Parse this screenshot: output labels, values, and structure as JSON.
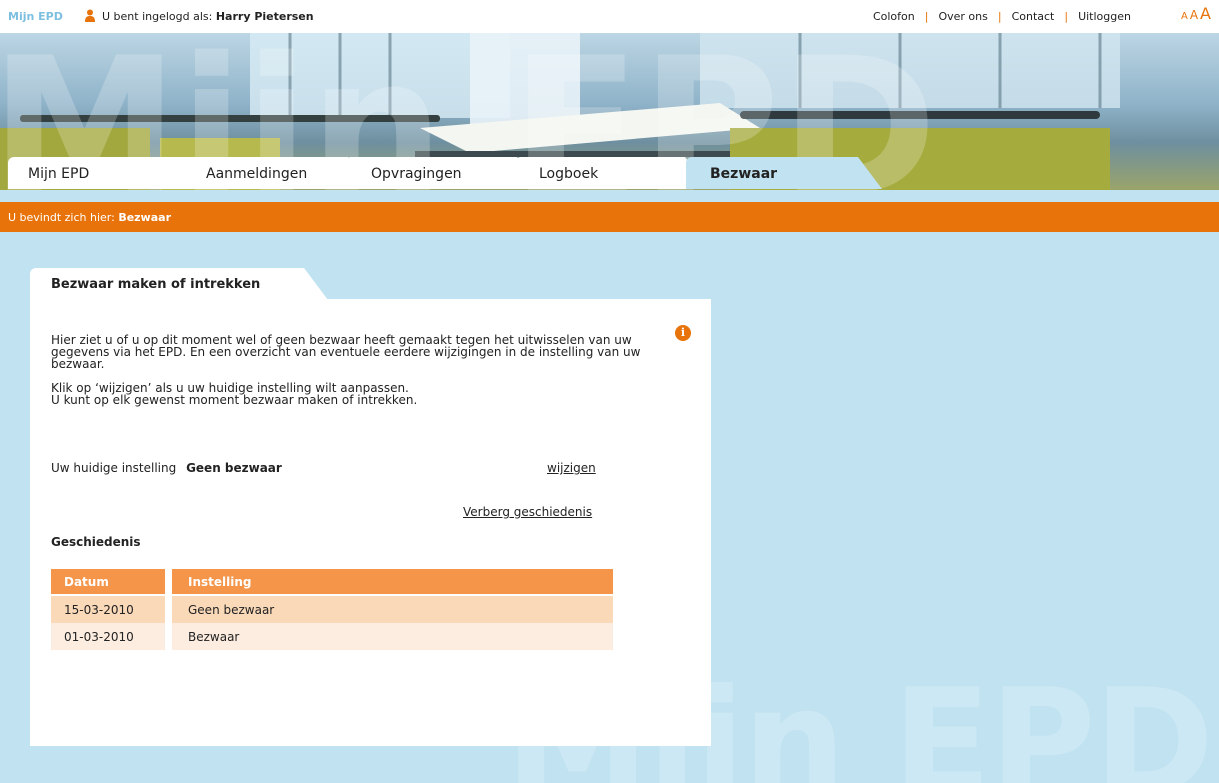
{
  "topbar": {
    "brand": "Mijn EPD",
    "logged_in_prefix": "U bent ingelogd als:",
    "user_name": "Harry Pietersen",
    "links": [
      "Colofon",
      "Over ons",
      "Contact",
      "Uitloggen"
    ],
    "font_sizes": [
      "A",
      "A",
      "A"
    ]
  },
  "tabs": [
    "Mijn EPD",
    "Aanmeldingen",
    "Opvragingen",
    "Logboek",
    "Bezwaar"
  ],
  "active_tab": "Bezwaar",
  "breadcrumb": {
    "prefix": "U bevindt zich hier:",
    "current": "Bezwaar"
  },
  "panel": {
    "title": "Bezwaar maken of intrekken",
    "intro_1": "Hier ziet u of u op dit moment wel of geen bezwaar heeft gemaakt tegen het uitwisselen van uw gegevens via het EPD. En een overzicht van eventuele eerdere wijzigingen in de instelling van uw bezwaar.",
    "intro_2a": "Klik op ‘wijzigen’ als u uw huidige instelling wilt aanpassen.",
    "intro_2b": "U kunt op elk gewenst moment bezwaar maken of intrekken.",
    "current_label": "Uw huidige instelling",
    "current_value": "Geen bezwaar",
    "change_link": "wijzigen",
    "hide_history_link": "Verberg geschiedenis",
    "history_title": "Geschiedenis",
    "table": {
      "headers": [
        "Datum",
        "Instelling"
      ],
      "rows": [
        [
          "15-03-2010",
          "Geen bezwaar"
        ],
        [
          "01-03-2010",
          "Bezwaar"
        ]
      ]
    }
  },
  "watermark": "Mijn EPD",
  "colors": {
    "accent": "#e8730a",
    "background": "#c1e2f0",
    "table_header": "#f4954a"
  }
}
